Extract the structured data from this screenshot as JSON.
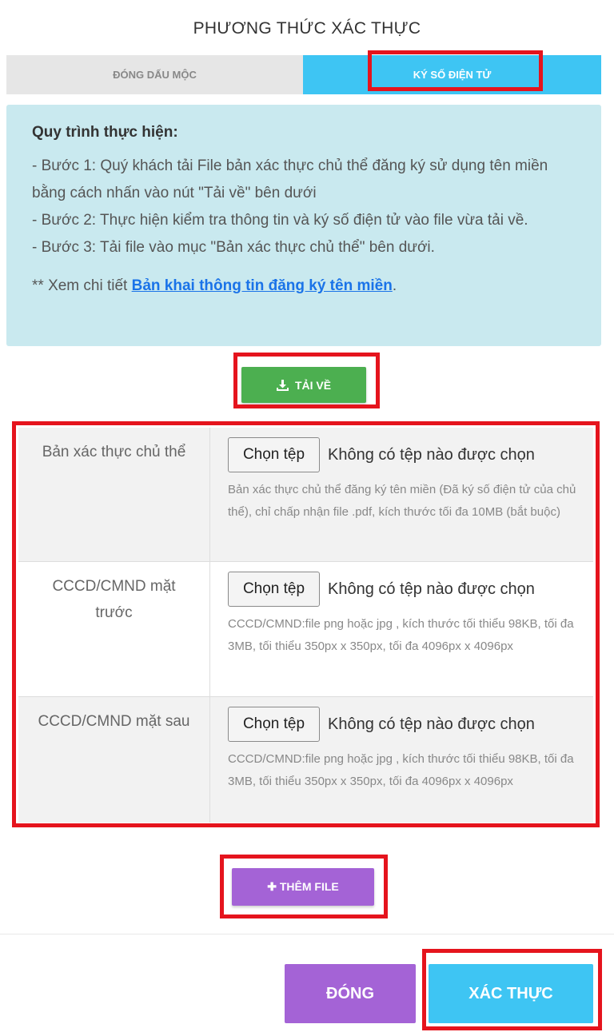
{
  "modal": {
    "title": "PHƯƠNG THỨC XÁC THỰC"
  },
  "tabs": [
    {
      "label": "ĐÓNG DẤU MỘC",
      "active": false
    },
    {
      "label": "KÝ SỐ ĐIỆN TỬ",
      "active": true
    }
  ],
  "instructions": {
    "heading": "Quy trình thực hiện:",
    "step1": "- Bước 1: Quý khách tải File bản xác thực chủ thể đăng ký sử dụng tên miền bằng cách nhấn vào nút \"Tải về\" bên dưới",
    "step2": "- Bước 2: Thực hiện kiểm tra thông tin và ký số điện tử vào file vừa tải về.",
    "step3": "- Bước 3: Tải file vào mục \"Bản xác thực chủ thể\" bên dưới.",
    "more_prefix": "** Xem chi tiết ",
    "more_link": "Bản khai thông tin đăng ký tên miền",
    "more_suffix": "."
  },
  "download_button": {
    "label": "TẢI VỀ",
    "icon": "download-icon"
  },
  "file_rows": [
    {
      "label": "Bản xác thực chủ thể",
      "choose_label": "Chọn tệp",
      "status": "Không có tệp nào được chọn",
      "hint": "Bản xác thực chủ thể đăng ký tên miền (Đã ký số điện tử của chủ thể), chỉ chấp nhận file .pdf, kích thước tối đa 10MB (bắt buộc)"
    },
    {
      "label": "CCCD/CMND mặt trước",
      "choose_label": "Chọn tệp",
      "status": "Không có tệp nào được chọn",
      "hint": "CCCD/CMND:file png hoặc jpg , kích thước tối thiểu 98KB, tối đa 3MB, tối thiểu 350px x 350px, tối đa 4096px x 4096px"
    },
    {
      "label": "CCCD/CMND mặt sau",
      "choose_label": "Chọn tệp",
      "status": "Không có tệp nào được chọn",
      "hint": "CCCD/CMND:file png hoặc jpg , kích thước tối thiểu 98KB, tối đa 3MB, tối thiểu 350px x 350px, tối đa 4096px x 4096px"
    }
  ],
  "add_file_button": {
    "label": "THÊM FILE",
    "icon": "plus-icon"
  },
  "footer": {
    "close_label": "ĐÓNG",
    "verify_label": "XÁC THỰC"
  },
  "colors": {
    "accent_blue": "#3ec5f3",
    "download_green": "#4caf50",
    "purple": "#a463d6",
    "highlight_red": "#e5141d",
    "info_bg": "#c9e9ef"
  }
}
